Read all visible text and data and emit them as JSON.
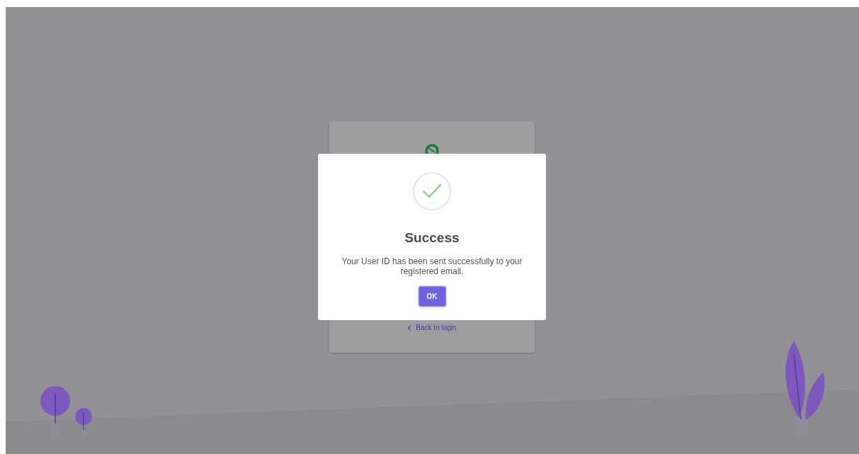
{
  "background_card": {
    "back_link": "Back to login"
  },
  "dialog": {
    "title": "Success",
    "message": "Your User ID has been sent successfully to your registered email.",
    "button": "OK"
  }
}
